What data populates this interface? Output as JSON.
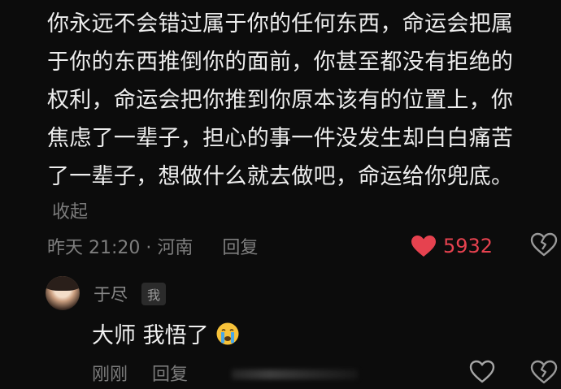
{
  "comment": {
    "lines": [
      "你永远不会错过属于你的任何东西，命运会把属",
      "于你的东西推倒你的面前，你甚至都没有拒绝的",
      "权利，命运会把你推到你原本该有的位置上，你",
      "焦虑了一辈子，担心的事一件没发生却白白痛苦",
      "了一辈子，想做什么就去做吧，命运给你兜底。"
    ],
    "collapse_label": "收起",
    "time_location": "昨天 21:20 · 河南",
    "reply_label": "回复",
    "like_count": "5932",
    "like_icon": "heart-filled-icon",
    "dislike_icon": "broken-heart-icon"
  },
  "reply": {
    "author": "于尽",
    "badge": "我",
    "text": "大师 我悟了",
    "emoji": "crying-face-emoji",
    "time": "刚刚",
    "reply_label": "回复",
    "like_icon": "heart-outline-icon",
    "dislike_icon": "broken-heart-icon"
  },
  "colors": {
    "background": "#0c0c0c",
    "like_red": "#e6424f",
    "text": "#ededed",
    "muted": "#7b7b7b"
  }
}
